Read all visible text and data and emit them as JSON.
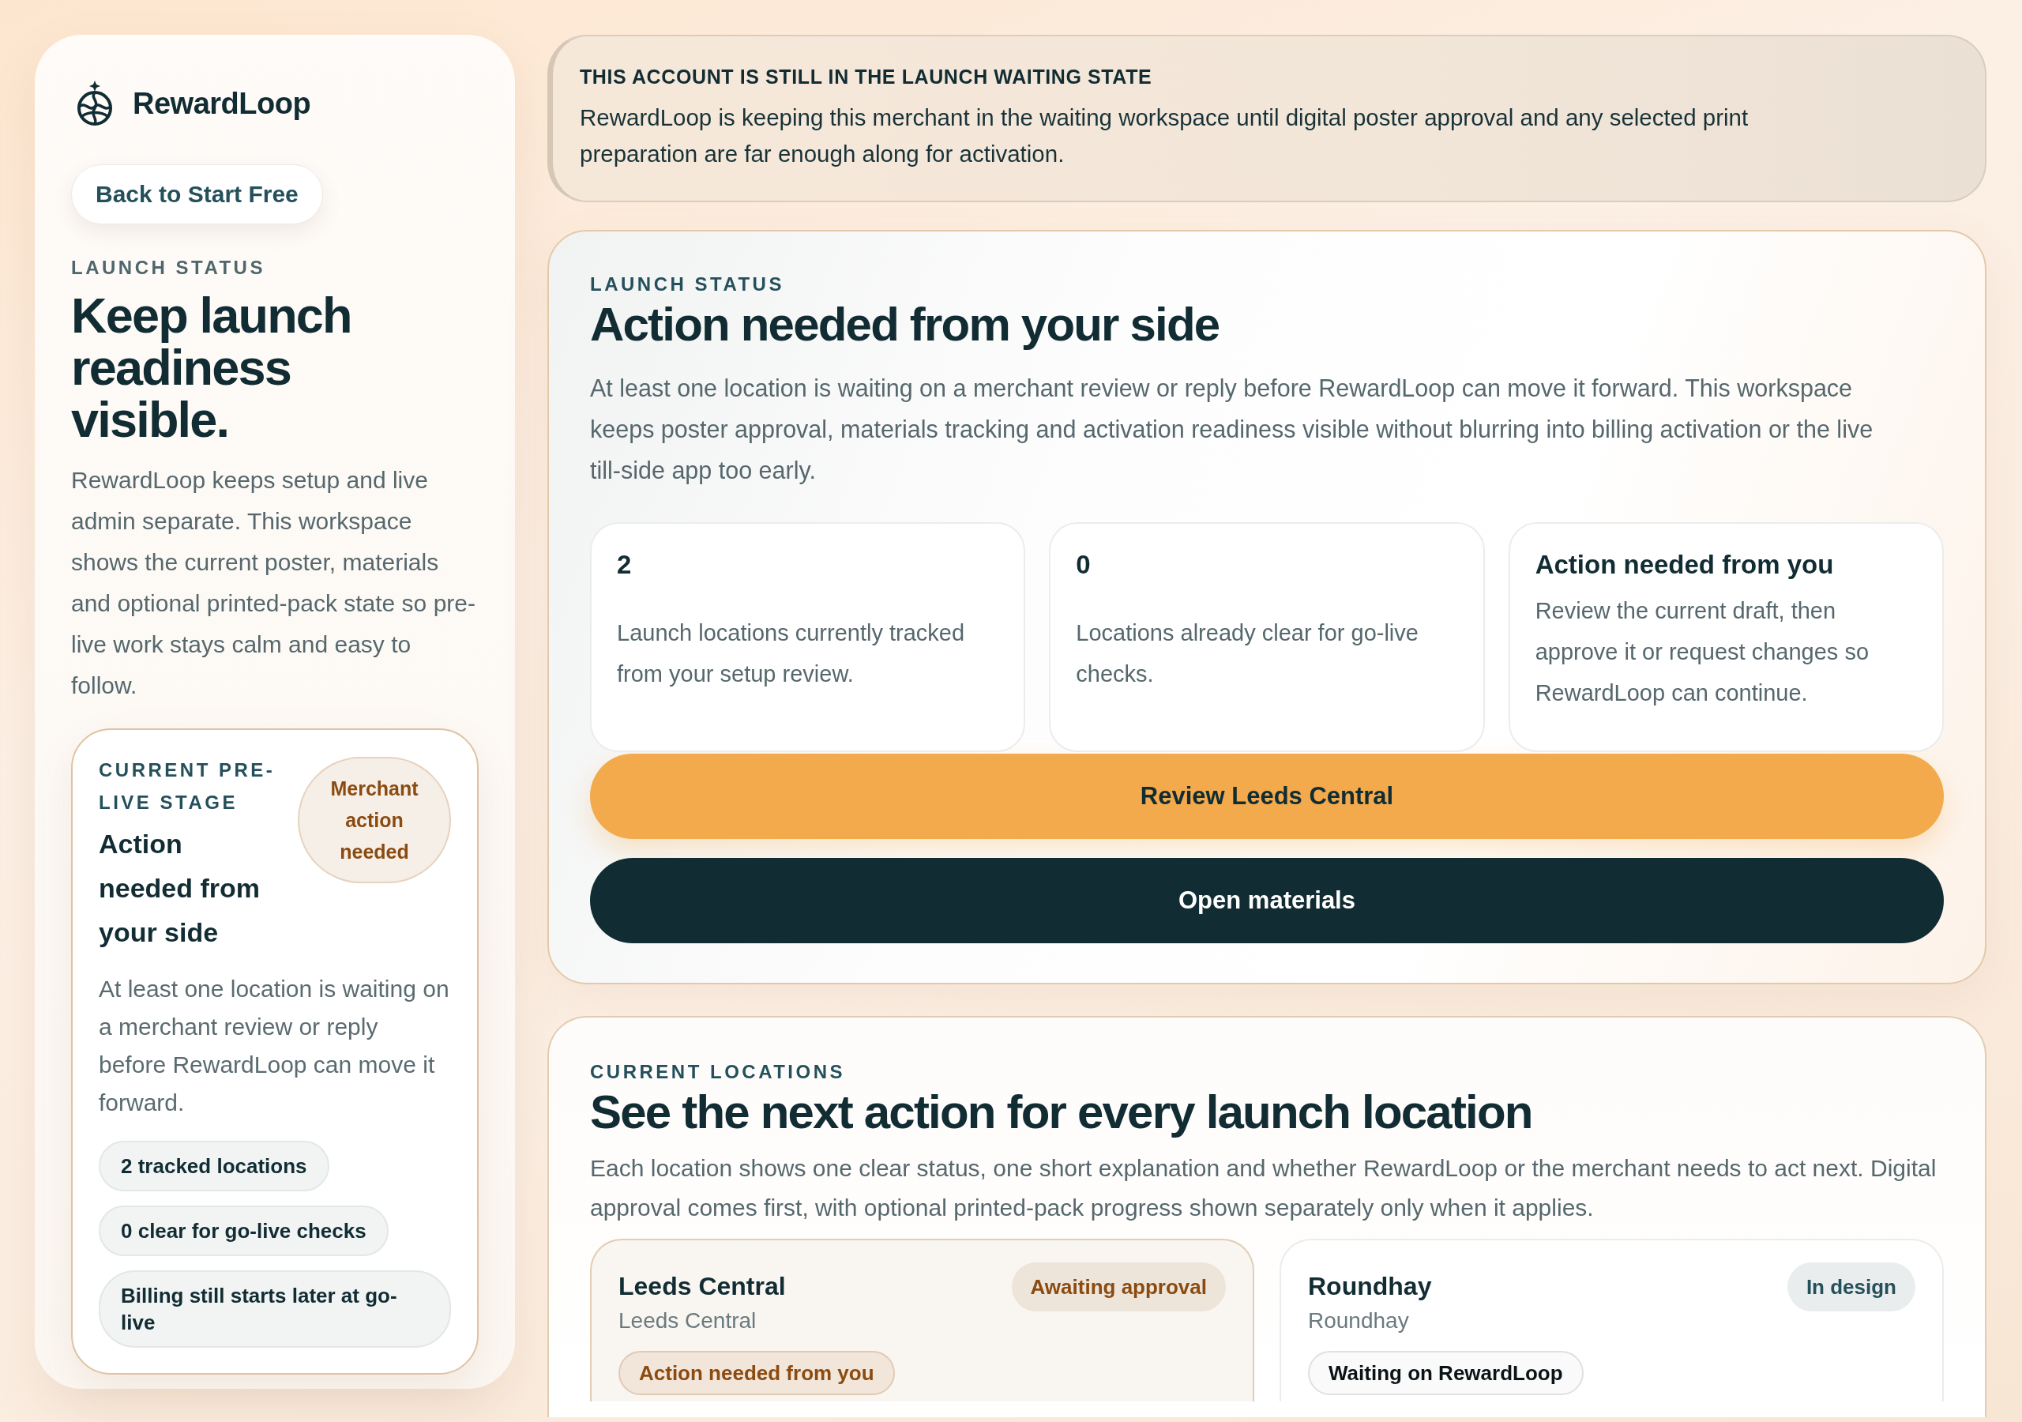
{
  "sidebar": {
    "brand": "RewardLoop",
    "back_button": "Back to Start Free",
    "eyebrow": "LAUNCH STATUS",
    "heading": "Keep launch readiness visible.",
    "intro": "RewardLoop keeps setup and live admin separate. This workspace shows the current poster, materials and optional printed-pack state so pre-live work stays calm and easy to follow.",
    "stage_card": {
      "eyebrow": "CURRENT PRE-LIVE STAGE",
      "title": "Action needed from your side",
      "badge": "Merchant action needed",
      "description": "At least one location is waiting on a merchant review or reply before RewardLoop can move it forward.",
      "chips": [
        "2 tracked locations",
        "0 clear for go-live checks",
        "Billing still starts later at go-live"
      ]
    }
  },
  "banner": {
    "title": "THIS ACCOUNT IS STILL IN THE LAUNCH WAITING STATE",
    "message": "RewardLoop is keeping this merchant in the waiting workspace until digital poster approval and any selected print preparation are far enough along for activation."
  },
  "launch_status": {
    "eyebrow": "LAUNCH STATUS",
    "heading": "Action needed from your side",
    "description": "At least one location is waiting on a merchant review or reply before RewardLoop can move it forward. This workspace keeps poster approval, materials tracking and activation readiness visible without blurring into billing activation or the live till-side app too early.",
    "stats": [
      {
        "kind": "count",
        "value": "2",
        "text": "Launch locations currently tracked from your setup review."
      },
      {
        "kind": "count",
        "value": "0",
        "text": "Locations already clear for go-live checks."
      },
      {
        "kind": "note",
        "value": "Action needed from you",
        "text": "Review the current draft, then approve it or request changes so RewardLoop can continue."
      }
    ],
    "actions": [
      {
        "kind": "primary",
        "label": "Review Leeds Central"
      },
      {
        "kind": "secondary",
        "label": "Open materials"
      }
    ]
  },
  "locations": {
    "eyebrow": "CURRENT LOCATIONS",
    "heading": "See the next action for every launch location",
    "description": "Each location shows one clear status, one short explanation and whether RewardLoop or the merchant needs to act next. Digital approval comes first, with optional printed-pack progress shown separately only when it applies.",
    "items": [
      {
        "name": "Leeds Central",
        "area": "Leeds Central",
        "status": {
          "label": "Awaiting approval",
          "color": "#8b4a0f"
        },
        "needs_action": true,
        "next_step": "Action needed from you"
      },
      {
        "name": "Roundhay",
        "area": "Roundhay",
        "status": {
          "label": "In design",
          "color": "#24505b"
        },
        "needs_action": false,
        "next_step": "Waiting on RewardLoop"
      }
    ]
  }
}
